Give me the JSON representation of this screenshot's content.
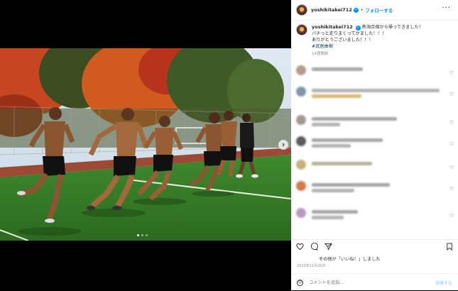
{
  "post": {
    "username": "yoshikitakei712",
    "follow_label": "フォローする",
    "separator": "•",
    "caption_line1": "熱海合宿から帰ってきました！",
    "caption_line2": "バチっと走りまくってかました！！！",
    "caption_line3": "ありがとうございました！！！",
    "hashtag": "#武居由樹",
    "caption_age": "14週間前",
    "likes_text": "その他が「いいね！」しました",
    "date": "2023年11月25日",
    "comment_placeholder": "コメントを追加...",
    "post_label": "投稿する"
  },
  "carousel": {
    "current": 1,
    "total": 3
  },
  "icons": [
    "more-options-icon",
    "verified-badge-icon",
    "heart-icon",
    "comment-icon",
    "share-icon",
    "bookmark-icon",
    "emoji-icon",
    "chevron-right-icon"
  ],
  "colors": {
    "link": "#0095f6",
    "text": "#262626",
    "muted": "#8e8e8e",
    "hashtag": "#00376b"
  }
}
